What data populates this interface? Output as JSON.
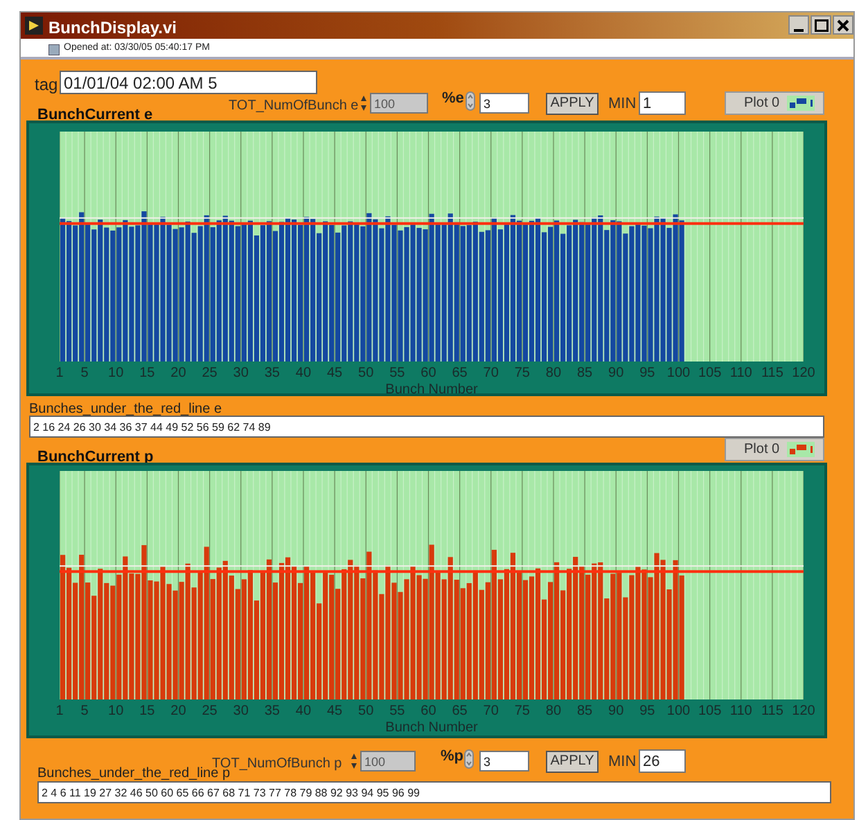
{
  "window": {
    "title": "BunchDisplay.vi"
  },
  "info_bar": {
    "text": "Opened at: 03/30/05 05:40:17 PM"
  },
  "tag": {
    "label": "tag",
    "value": "01/01/04 02:00 AM 5"
  },
  "panels": [
    {
      "title": "BunchCurrent e",
      "color": "#1448a0",
      "tot_label": "TOT_NumOfBunch e",
      "tot_value": "100",
      "percent_label": "%e",
      "percent_value": "3",
      "apply": "APPLY",
      "min_label": "MIN",
      "min_value": "1",
      "plot_button": "Plot 0",
      "x_ticks": [
        "1",
        "5",
        "10",
        "15",
        "20",
        "25",
        "30",
        "35",
        "40",
        "45",
        "50",
        "55",
        "60",
        "65",
        "70",
        "75",
        "80",
        "85",
        "90",
        "95",
        "100",
        "105",
        "110",
        "115",
        "120"
      ],
      "xlabel": "Bunch Number",
      "list_label": "Bunches_under_the_red_line e",
      "list_value": "2 16 24 26 30 34 36 37 44 49 52 56 59 62 74 89"
    },
    {
      "title": "BunchCurrent p",
      "color": "#d83a0c",
      "tot_label": "TOT_NumOfBunch p",
      "tot_value": "100",
      "percent_label": "%p",
      "percent_value": "3",
      "apply": "APPLY",
      "min_label": "MIN",
      "min_value": "26",
      "plot_button": "Plot 0",
      "x_ticks": [
        "1",
        "5",
        "10",
        "15",
        "20",
        "25",
        "30",
        "35",
        "40",
        "45",
        "50",
        "55",
        "60",
        "65",
        "70",
        "75",
        "80",
        "85",
        "90",
        "95",
        "100",
        "105",
        "110",
        "115",
        "120"
      ],
      "xlabel": "Bunch Number",
      "list_label": "Bunches_under_the_red_line p",
      "list_value": "2 4 6 11 19 27 32 46 50 60 65 66 67 68 71 73 77 78 79 88 92 93 94 95 96 99"
    }
  ]
}
